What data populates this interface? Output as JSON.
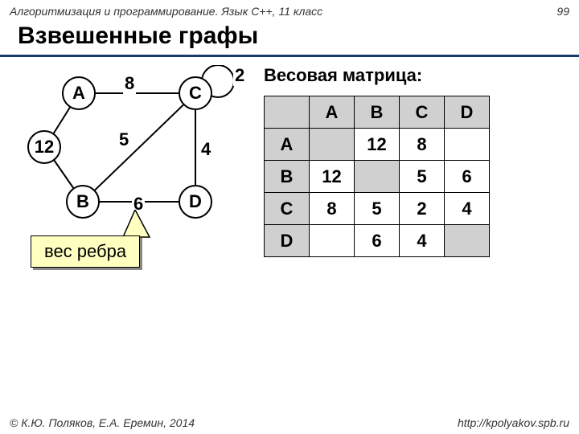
{
  "header": {
    "left": "Алгоритмизация и программирование. Язык C++, 11 класс",
    "right": "99"
  },
  "title": "Взвешенные графы",
  "graph": {
    "nodes": {
      "A": "A",
      "B": "B",
      "C": "C",
      "D": "D"
    },
    "edges": {
      "AC": "8",
      "AB": "12",
      "BC": "5",
      "BD": "6",
      "CD": "4",
      "CC": "2"
    },
    "callout": "вес ребра"
  },
  "matrix": {
    "title": "Весовая матрица:",
    "headers": [
      "A",
      "B",
      "C",
      "D"
    ],
    "rows": [
      {
        "label": "A",
        "cells": [
          "",
          "12",
          "8",
          ""
        ]
      },
      {
        "label": "B",
        "cells": [
          "12",
          "",
          "5",
          "6"
        ]
      },
      {
        "label": "C",
        "cells": [
          "8",
          "5",
          "2",
          "4"
        ]
      },
      {
        "label": "D",
        "cells": [
          "",
          "6",
          "4",
          ""
        ]
      }
    ]
  },
  "footer": {
    "left": "© К.Ю. Поляков, Е.А. Еремин, 2014",
    "right": "http://kpolyakov.spb.ru"
  }
}
